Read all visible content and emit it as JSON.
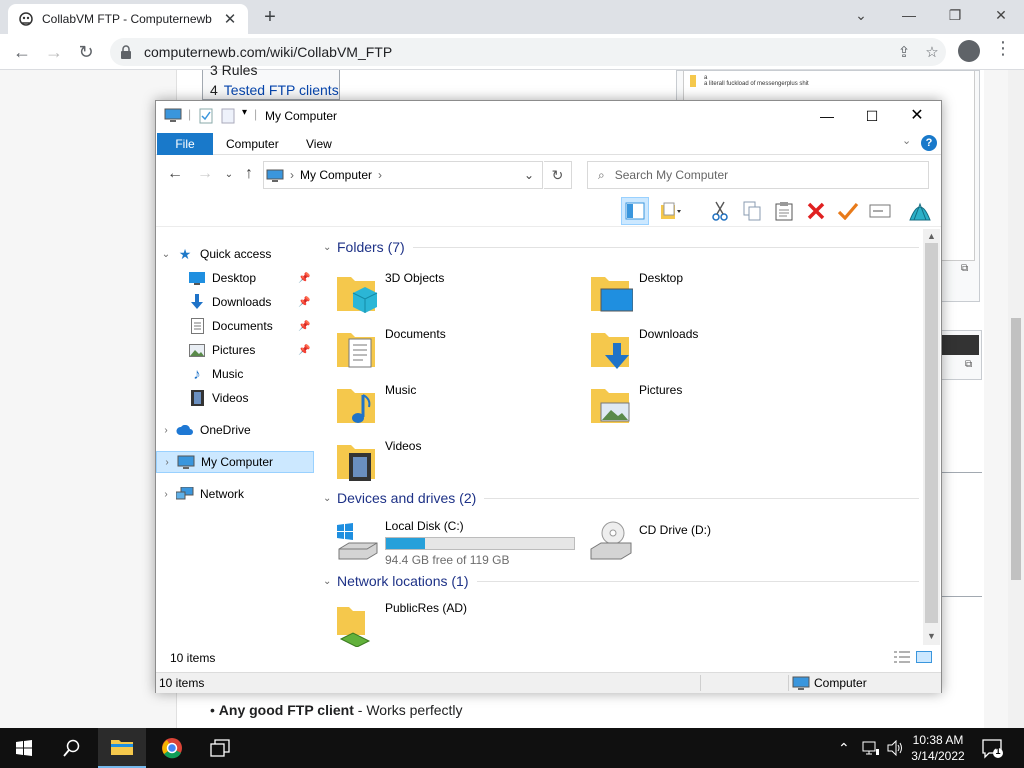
{
  "browser": {
    "tab_title": "CollabVM FTP - Computernewb",
    "url": "computernewb.com/wiki/CollabVM_FTP",
    "new_tab_label": "+"
  },
  "webpage": {
    "toc_prev": "3  Rules",
    "toc_item_num": "4",
    "toc_item_label": "Tested FTP clients",
    "thumb_caption_line1": "a",
    "thumb_caption_line2": "a literall fuckload of messengerplus shit",
    "bullet_bold": "Any good FTP client",
    "bullet_rest": " - Works perfectly"
  },
  "explorer": {
    "window_title": "My Computer",
    "ribbon_tabs": [
      "File",
      "Computer",
      "View"
    ],
    "address_location": "My Computer",
    "search_placeholder": "Search My Computer",
    "nav": {
      "quick_access": "Quick access",
      "items": [
        {
          "label": "Desktop",
          "pinned": true
        },
        {
          "label": "Downloads",
          "pinned": true
        },
        {
          "label": "Documents",
          "pinned": true
        },
        {
          "label": "Pictures",
          "pinned": true
        },
        {
          "label": "Music",
          "pinned": false
        },
        {
          "label": "Videos",
          "pinned": false
        }
      ],
      "onedrive": "OneDrive",
      "my_computer": "My Computer",
      "network": "Network"
    },
    "groups": {
      "folders": "Folders (7)",
      "devices": "Devices and drives (2)",
      "network": "Network locations (1)"
    },
    "folders": [
      "3D Objects",
      "Desktop",
      "Documents",
      "Downloads",
      "Music",
      "Pictures",
      "Videos"
    ],
    "drives": {
      "c_label": "Local Disk (C:)",
      "c_free": "94.4 GB free of 119 GB",
      "c_used_fraction": 0.207,
      "d_label": "CD Drive (D:)"
    },
    "network_locations": [
      "PublicRes (AD)"
    ],
    "inner_status": "10 items",
    "status_left": "10 items",
    "status_right": "Computer"
  },
  "taskbar": {
    "time": "10:38 AM",
    "date": "3/14/2022",
    "notification_count": "1"
  },
  "colors": {
    "accent": "#1979ca",
    "selection": "#cce8ff",
    "folder_yellow": "#f5c84c",
    "drive_fill": "#26a0da"
  }
}
